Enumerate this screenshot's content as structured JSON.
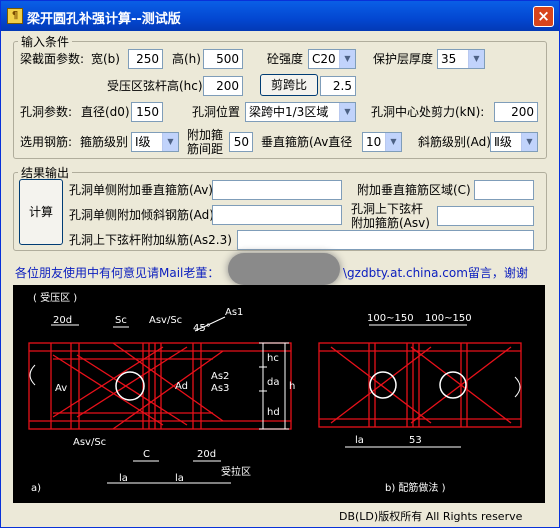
{
  "window": {
    "title": "梁开圆孔补强计算--测试版",
    "icon": "app-icon",
    "close": "×"
  },
  "input_group": {
    "legend": "输入条件",
    "section_label": "梁截面参数:",
    "width_label": "宽(b)",
    "width_value": "250",
    "height_label": "高(h)",
    "height_value": "500",
    "concrete_label": "砼强度",
    "concrete_value": "C20",
    "cover_label": "保护层厚度",
    "cover_value": "35",
    "hc_label": "受压区弦杆高(hc)",
    "hc_value": "200",
    "shear_span_button": "剪跨比",
    "shear_span_value": "2.5",
    "hole_label": "孔洞参数:",
    "d0_label": "直径(d0)",
    "d0_value": "150",
    "position_label": "孔洞位置",
    "position_value": "梁跨中1/3区域",
    "shear_label": "孔洞中心处剪力(kN):",
    "shear_value": "200",
    "rebar_label": "选用钢筋:",
    "stirrup_grade_label": "箍筋级别",
    "stirrup_grade_value": "Ⅰ级",
    "extra_spacing_label_1": "附加箍",
    "extra_spacing_label_2": "筋间距",
    "extra_spacing_value": "50",
    "av_label": "垂直箍筋(Av直径",
    "av_value": "10",
    "ad_label": "斜筋级别(Ad)",
    "ad_value": "Ⅱ级"
  },
  "result_group": {
    "legend": "结果输出",
    "calc_button": "计算",
    "av_label": "孔洞单侧附加垂直箍筋(Av)",
    "av_value": "",
    "c_label": "附加垂直箍筋区域(C)",
    "c_value": "",
    "ad_label": "孔洞单侧附加倾斜钢筋(Ad)",
    "ad_value": "",
    "asv_label_1": "孔洞上下弦杆",
    "asv_label_2": "附加箍筋(Asv)",
    "asv_value": "",
    "as23_label": "孔洞上下弦杆附加纵筋(As2.3)",
    "as23_value": ""
  },
  "contact": {
    "left": "各位朋友使用中有何意见请Mail老董：",
    "right": "\\gzdbty.at.china.com留言，谢谢"
  },
  "diagram": {
    "zone_a": "( 受压区 )",
    "label_20d_1": "20d",
    "label_sc": "Sc",
    "label_asv_sc": "Asv/Sc",
    "label_as1": "As1",
    "label_45": "45°",
    "label_av": "Av",
    "label_ad": "Ad",
    "label_as2": "As2",
    "label_as3": "As3",
    "label_hc": "hc",
    "label_da": "da",
    "label_h": "h",
    "label_hd": "hd",
    "label_asv_sc2": "Asv/Sc",
    "label_c": "C",
    "label_20d_2": "20d",
    "label_la_1": "la",
    "label_la_2": "la",
    "zone_b": "受拉区",
    "part_a": "a)",
    "label_100_150_1": "100~150",
    "label_100_150_2": "100~150",
    "label_la_3": "la",
    "label_53": "53",
    "part_b": "b) 配筋做法 )"
  },
  "copyright": "DB(LD)版权所有 All Rights reserve",
  "colors": {
    "title_bar": "#0347d1",
    "diagram_bg": "#000000",
    "rebar_red": "#e8111a",
    "dim_white": "#ffffff",
    "contact_blue": "#0a1dbe"
  }
}
